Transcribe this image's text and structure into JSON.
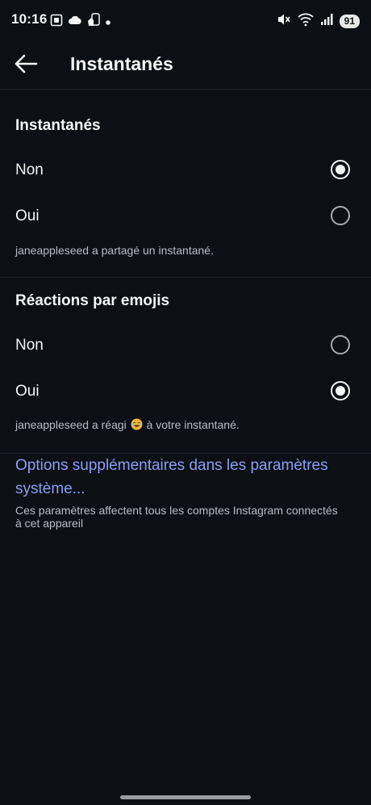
{
  "status_bar": {
    "time": "10:16",
    "battery": "91",
    "left_icons": [
      "screenshot-icon",
      "cloud-icon",
      "app-notification-icon",
      "dot-icon"
    ],
    "right_icons": [
      "mute-icon",
      "wifi-icon",
      "signal-icon"
    ]
  },
  "header": {
    "title": "Instantanés",
    "back_icon": "arrow-left-icon"
  },
  "sections": {
    "snapshots": {
      "title": "Instantanés",
      "options": [
        {
          "label": "Non",
          "selected": true
        },
        {
          "label": "Oui",
          "selected": false
        }
      ],
      "preview": "janeappleseed a partagé un instantané."
    },
    "emoji_reactions": {
      "title": "Réactions par emojis",
      "options": [
        {
          "label": "Non",
          "selected": false
        },
        {
          "label": "Oui",
          "selected": true
        }
      ],
      "preview_before": "janeappleseed a réagi",
      "preview_emoji": "laughing-face-emoji",
      "preview_after": "à votre instantané."
    }
  },
  "system_options": {
    "link": "Options supplémentaires dans les paramètres système...",
    "note": "Ces paramètres affectent tous les comptes Instagram connectés à cet appareil"
  },
  "colors": {
    "background": "#0c0f14",
    "link": "#8a9ff5",
    "secondary_text": "#b8bcc2"
  }
}
